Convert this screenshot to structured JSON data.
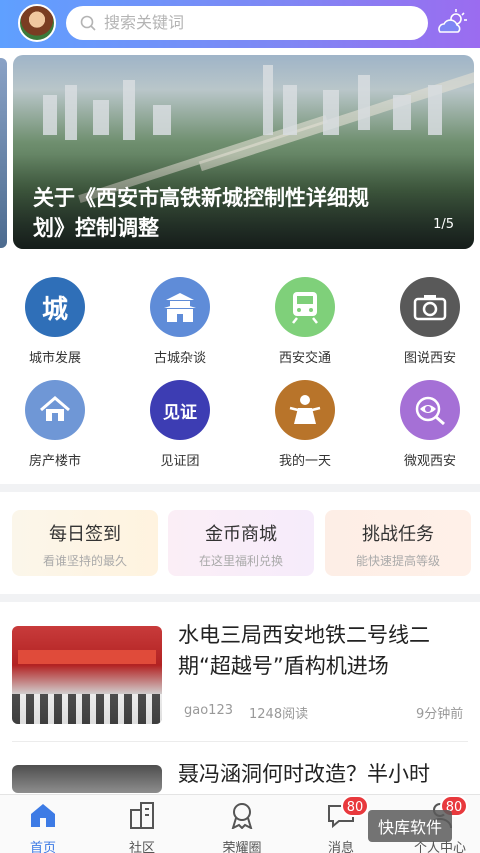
{
  "header": {
    "search_placeholder": "搜索关键词"
  },
  "banner": {
    "title": "关于《西安市高铁新城控制性详细规划》控制调整",
    "pager": "1/5"
  },
  "categories": [
    {
      "label": "城市发展",
      "glyph": "城",
      "icon": "city-icon",
      "color": "#2f6fb8"
    },
    {
      "label": "古城杂谈",
      "icon": "gate-tower-icon",
      "color": "#5f8cd8"
    },
    {
      "label": "西安交通",
      "icon": "train-icon",
      "color": "#7fd07a"
    },
    {
      "label": "图说西安",
      "icon": "camera-icon",
      "color": "#595959"
    },
    {
      "label": "房产楼市",
      "icon": "house-icon",
      "color": "#6f97d6"
    },
    {
      "label": "见证团",
      "glyph": "见证",
      "icon": "witness-icon",
      "color": "#3d3db3"
    },
    {
      "label": "我的一天",
      "icon": "person-icon",
      "color": "#b8742a"
    },
    {
      "label": "微观西安",
      "icon": "eye-icon",
      "color": "#a570d6"
    }
  ],
  "cards": [
    {
      "title": "每日签到",
      "subtitle": "看谁坚持的最久"
    },
    {
      "title": "金币商城",
      "subtitle": "在这里福利兑换"
    },
    {
      "title": "挑战任务",
      "subtitle": "能快速提高等级"
    }
  ],
  "news": [
    {
      "title": "水电三局西安地铁二号线二期“超越号”盾构机进场",
      "author": "gao123",
      "reads": "1248阅读",
      "time": "9分钟前"
    },
    {
      "title": "聂冯涵洞何时改造？半小时"
    }
  ],
  "tabs": [
    {
      "label": "首页",
      "icon": "home-icon"
    },
    {
      "label": "社区",
      "icon": "buildings-icon"
    },
    {
      "label": "荣耀圈",
      "icon": "honor-circle-icon"
    },
    {
      "label": "消息",
      "icon": "message-icon",
      "badge": "80"
    },
    {
      "label": "个人中心",
      "icon": "user-icon",
      "badge": "80"
    }
  ],
  "watermark": "快库软件",
  "colors": {
    "accent": "#3d7be5",
    "badge": "#e8393d"
  }
}
